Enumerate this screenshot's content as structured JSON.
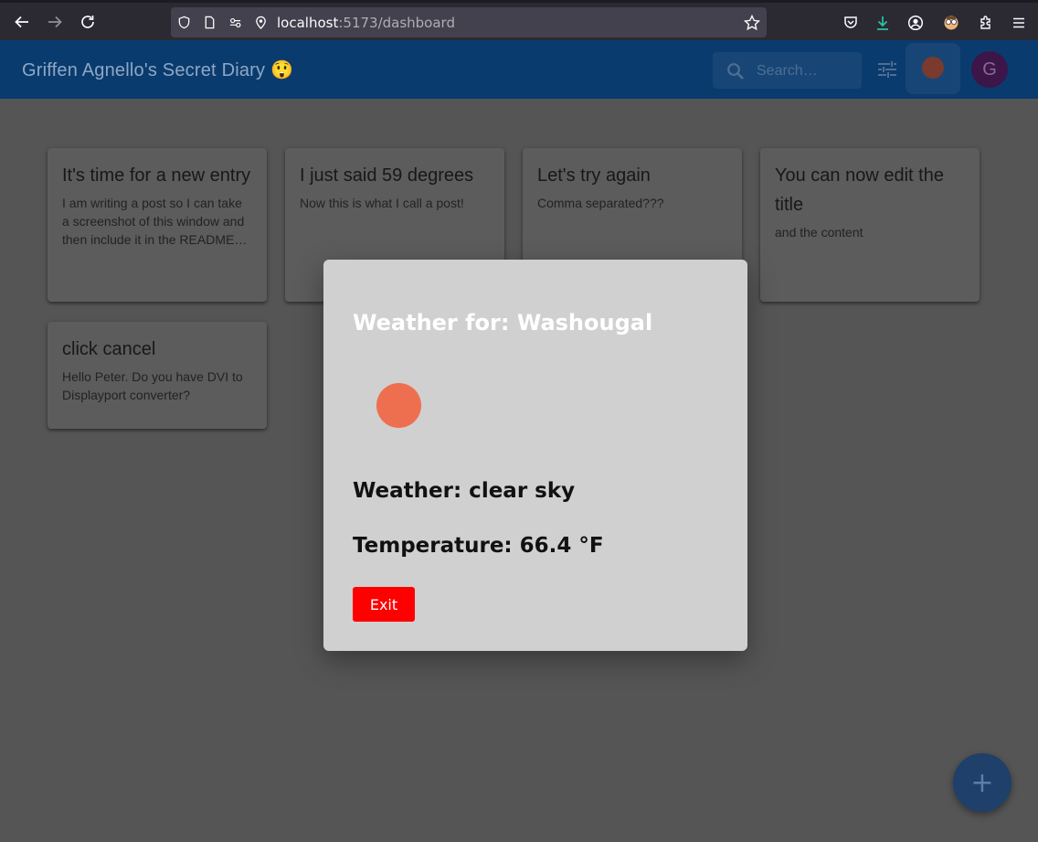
{
  "browser": {
    "url_host": "localhost",
    "url_path": ":5173/dashboard"
  },
  "app": {
    "title": "Griffen Agnello's Secret Diary 😲",
    "search_placeholder": "Search…",
    "avatar_letter": "G"
  },
  "cards": [
    {
      "title": "It's time for a new entry",
      "body": "I am writing a post so I can take a screenshot of this window and then include it in the README file"
    },
    {
      "title": "I just said 59 degrees",
      "body": "Now this is what I call a post!"
    },
    {
      "title": "Let's try again",
      "body": "Comma separated???"
    },
    {
      "title": "You can now edit the title",
      "body": "and the content"
    },
    {
      "title": "click cancel",
      "body": "Hello Peter. Do you have DVI to Displayport converter?"
    }
  ],
  "modal": {
    "title": "Weather for: Washougal",
    "weather": "Weather: clear sky",
    "temperature": "Temperature: 66.4 °F",
    "exit_label": "Exit"
  },
  "fab": {
    "label": "+"
  },
  "colors": {
    "app_bar": "#0a3b6e",
    "overlay_bg": "#555555",
    "modal_bg": "#d0d0d0",
    "sun": "#ee6f4f",
    "exit_button": "#ff0000"
  }
}
